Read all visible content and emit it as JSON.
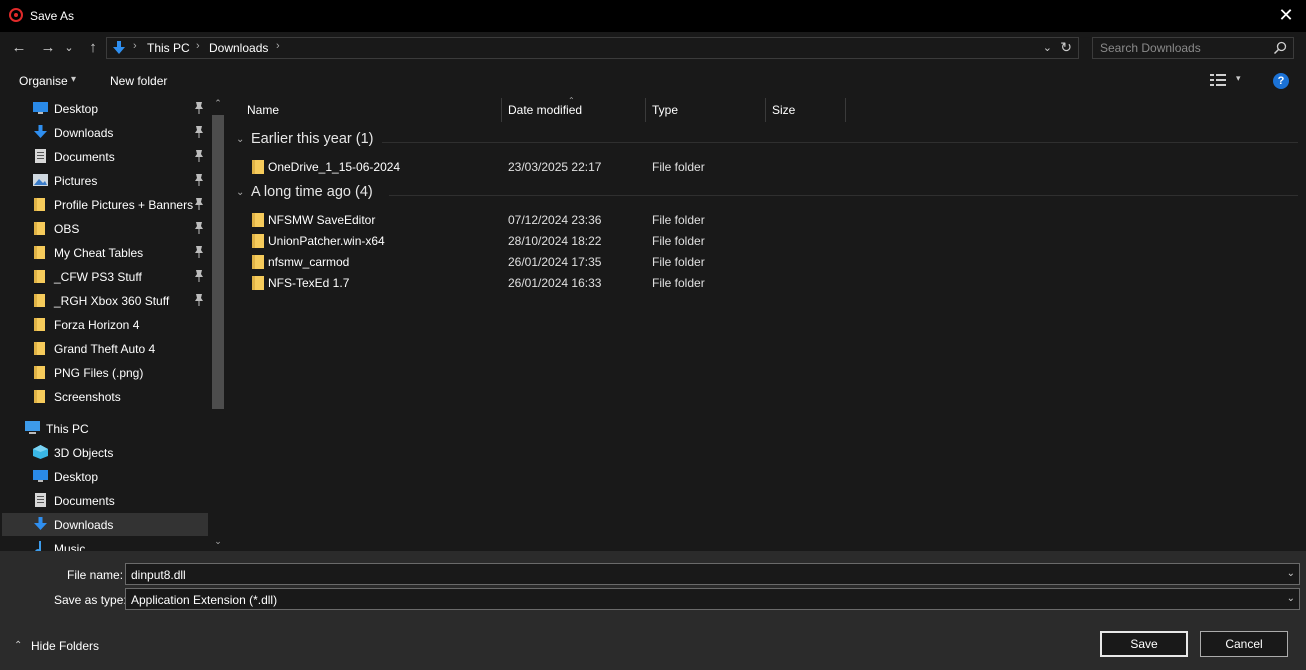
{
  "window": {
    "title": "Save As",
    "close_glyph": "✕"
  },
  "nav": {
    "back_glyph": "←",
    "forward_glyph": "→",
    "recent_glyph": "⌄",
    "up_glyph": "↑",
    "breadcrumb": [
      "This PC",
      "Downloads"
    ],
    "separator_glyph": "›",
    "dropdown_glyph": "⌄",
    "refresh_glyph": "↻"
  },
  "search": {
    "placeholder": "Search Downloads"
  },
  "toolbar": {
    "organise_label": "Organise",
    "organise_dd": "▾",
    "new_folder_label": "New folder",
    "view_dd": "▾",
    "help_label": "?"
  },
  "sidebar": {
    "quick_access": [
      {
        "label": "Desktop",
        "icon": "desktop-icon",
        "pinned": true
      },
      {
        "label": "Downloads",
        "icon": "downloads-icon",
        "pinned": true
      },
      {
        "label": "Documents",
        "icon": "documents-icon",
        "pinned": true
      },
      {
        "label": "Pictures",
        "icon": "pictures-icon",
        "pinned": true
      },
      {
        "label": "Profile Pictures + Banners",
        "icon": "folder-icon",
        "pinned": true
      },
      {
        "label": "OBS",
        "icon": "folder-icon",
        "pinned": true
      },
      {
        "label": "My Cheat Tables",
        "icon": "folder-icon",
        "pinned": true
      },
      {
        "label": "_CFW PS3 Stuff",
        "icon": "folder-icon",
        "pinned": true
      },
      {
        "label": "_RGH Xbox 360 Stuff",
        "icon": "folder-icon",
        "pinned": true
      },
      {
        "label": "Forza Horizon 4",
        "icon": "folder-icon",
        "pinned": false
      },
      {
        "label": "Grand Theft Auto 4",
        "icon": "folder-icon",
        "pinned": false
      },
      {
        "label": "PNG Files (.png)",
        "icon": "folder-icon",
        "pinned": false
      },
      {
        "label": "Screenshots",
        "icon": "folder-icon",
        "pinned": false
      }
    ],
    "this_pc_label": "This PC",
    "this_pc_items": [
      {
        "label": "3D Objects",
        "icon": "3d-objects-icon"
      },
      {
        "label": "Desktop",
        "icon": "desktop-icon"
      },
      {
        "label": "Documents",
        "icon": "documents-icon"
      },
      {
        "label": "Downloads",
        "icon": "downloads-icon",
        "selected": true
      },
      {
        "label": "Music",
        "icon": "music-icon"
      }
    ],
    "scroll_up": "⌃",
    "scroll_down": "⌄"
  },
  "columns": {
    "name": "Name",
    "date_modified": "Date modified",
    "type": "Type",
    "size": "Size",
    "sort_indicator": "⌃"
  },
  "groups": [
    {
      "label": "Earlier this year (1)",
      "chevron": "⌄",
      "files": [
        {
          "name": "OneDrive_1_15-06-2024",
          "date": "23/03/2025 22:17",
          "type": "File folder"
        }
      ]
    },
    {
      "label": "A long time ago (4)",
      "chevron": "⌄",
      "files": [
        {
          "name": "NFSMW SaveEditor",
          "date": "07/12/2024 23:36",
          "type": "File folder"
        },
        {
          "name": "UnionPatcher.win-x64",
          "date": "28/10/2024 18:22",
          "type": "File folder"
        },
        {
          "name": "nfsmw_carmod",
          "date": "26/01/2024 17:35",
          "type": "File folder"
        },
        {
          "name": "NFS-TexEd 1.7",
          "date": "26/01/2024 16:33",
          "type": "File folder"
        }
      ]
    }
  ],
  "footer": {
    "file_name_label": "File name:",
    "file_name_value": "dinput8.dll",
    "save_type_label": "Save as type:",
    "save_type_value": "Application Extension (*.dll)",
    "dropdown_glyph": "⌄",
    "hide_folders_label": "Hide Folders",
    "hide_folders_chev": "⌃",
    "save_label": "Save",
    "cancel_label": "Cancel"
  },
  "colors": {
    "folder": "#f6cb5b",
    "accent_blue": "#1b72d6",
    "app_icon": "#e02a2a"
  }
}
